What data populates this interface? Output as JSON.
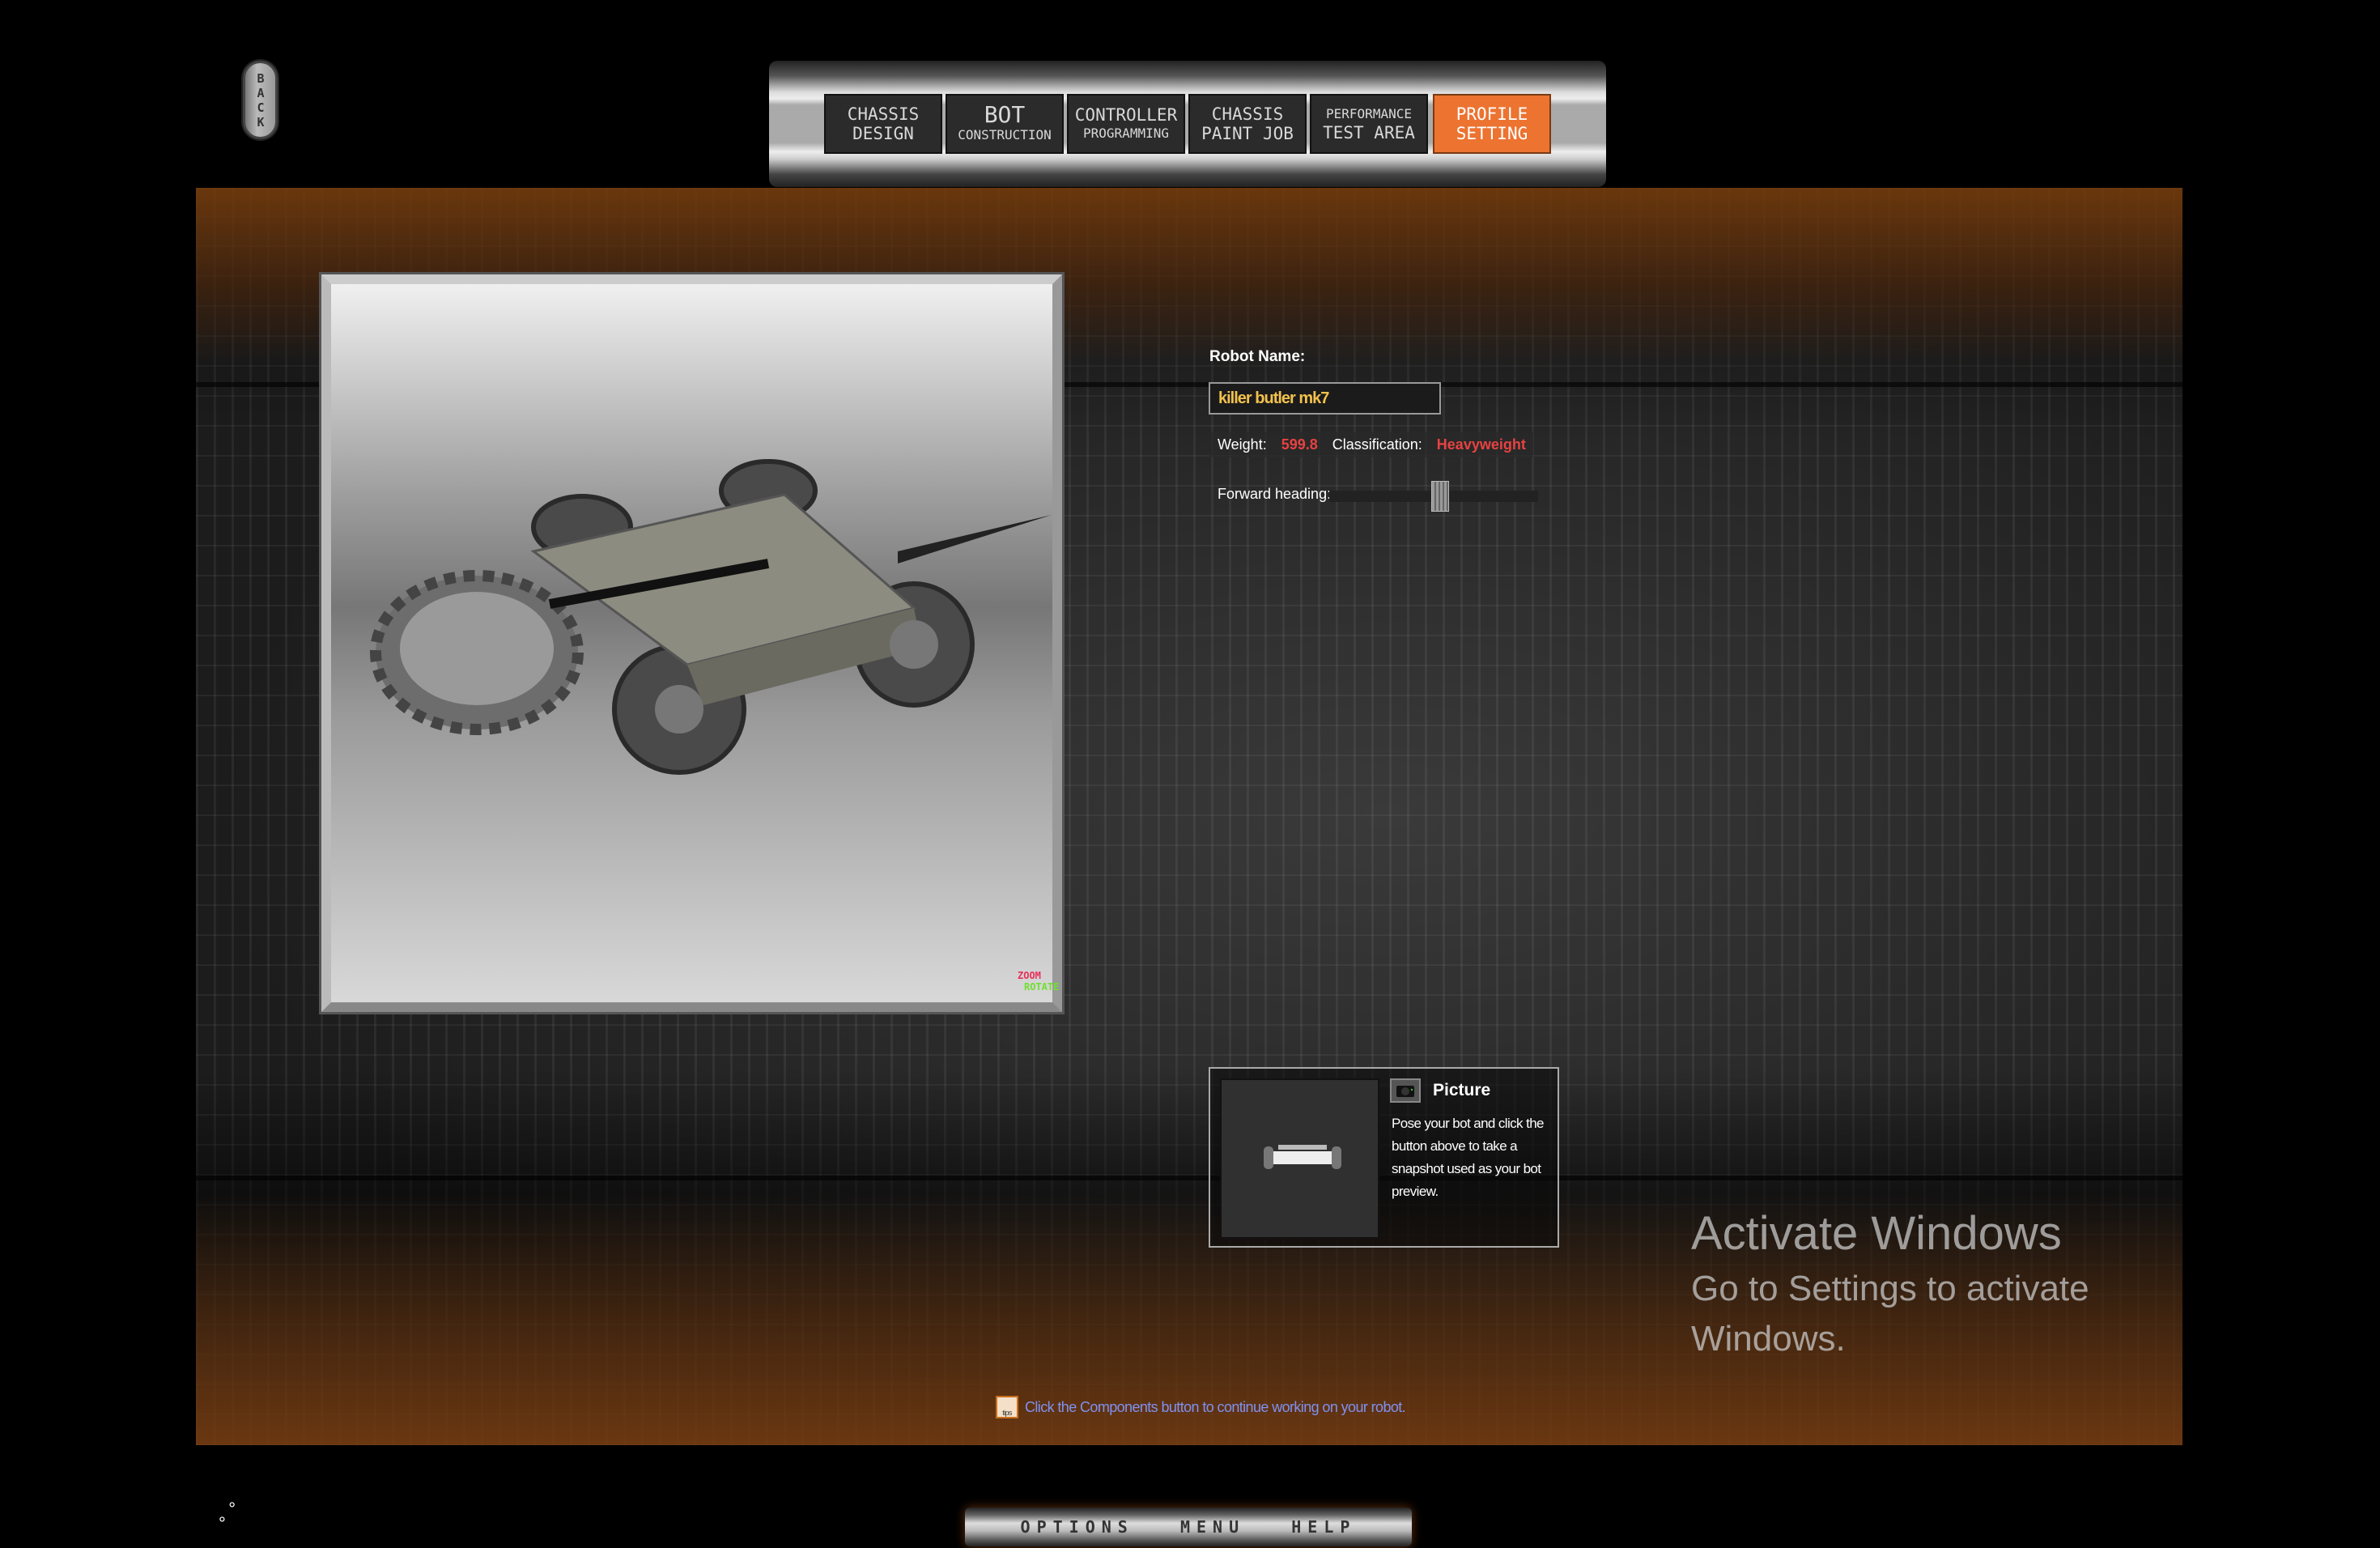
{
  "back_button": {
    "label": "BACK"
  },
  "nav": {
    "tabs": [
      {
        "line1": "CHASSIS",
        "line2": "DESIGN",
        "active": false
      },
      {
        "line1": "BOT",
        "line2": "CONSTRUCTION",
        "active": false
      },
      {
        "line1": "CONTROLLER",
        "line2": "PROGRAMMING",
        "active": false
      },
      {
        "line1": "CHASSIS",
        "line2": "PAINT JOB",
        "active": false
      },
      {
        "line1": "PERFORMANCE",
        "line2": "TEST AREA",
        "active": false
      },
      {
        "line1": "PROFILE",
        "line2": "SETTING",
        "active": true
      }
    ]
  },
  "viewport": {
    "legend_zoom": "ZOOM",
    "legend_rotate": "ROTATE"
  },
  "profile": {
    "name_label": "Robot Name:",
    "name_value": "killer butler mk7",
    "weight_label": "Weight:",
    "weight_value": "599.8",
    "classification_label": "Classification:",
    "classification_value": "Heavyweight",
    "heading_label": "Forward heading:",
    "heading_value_fraction": 0.5
  },
  "picture": {
    "title": "Picture",
    "description": "Pose your bot and click the button above to take a snapshot used as your bot preview."
  },
  "tip": {
    "icon_text": "tips",
    "text": "Click the Components button to continue working on your robot."
  },
  "bottom": {
    "options": "OPTIONS",
    "menu": "MENU",
    "help": "HELP"
  },
  "watermark": {
    "title": "Activate Windows",
    "subtitle": "Go to Settings to activate Windows."
  },
  "colors": {
    "accent": "#ec7330",
    "highlight_text": "#f2c14e",
    "warning": "#e84242",
    "tip_text": "#8090f0"
  }
}
